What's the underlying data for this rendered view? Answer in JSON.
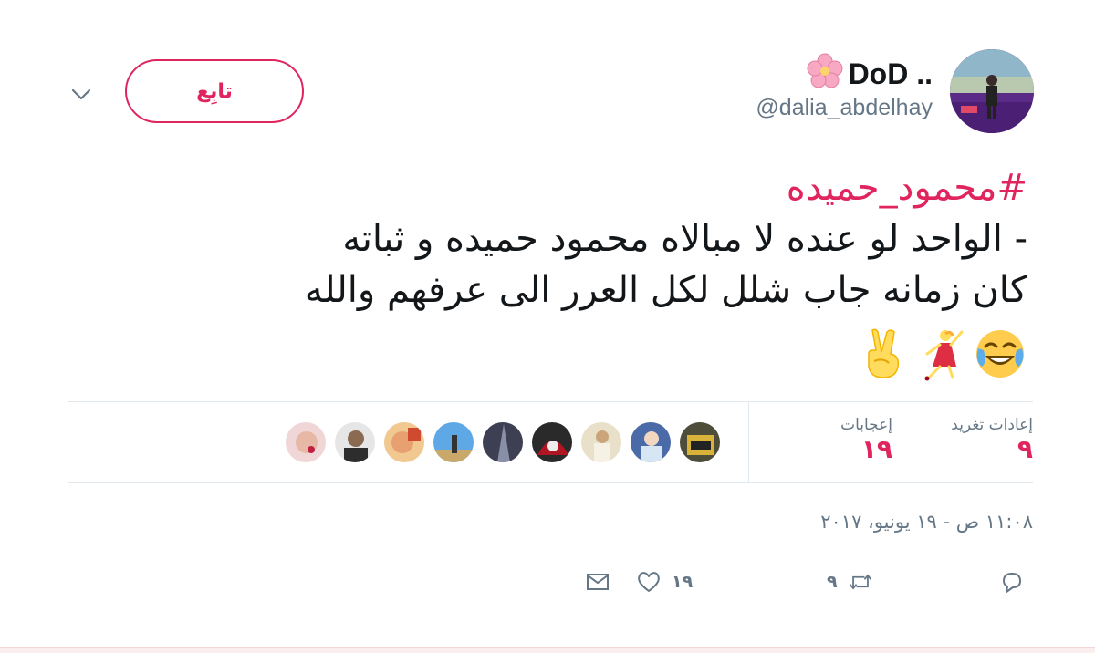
{
  "author": {
    "display_name": "DoD ..",
    "handle": "@dalia_abdelhay"
  },
  "header": {
    "follow_label": "تابِع",
    "caret_icon": "chevron-down-icon"
  },
  "tweet": {
    "hashtag": "#محمود_حميده",
    "line1": "- الواحد لو عنده لا مبالاه محمود حميده و ثباته",
    "line2": "كان زمانه جاب شلل لكل العرر الى عرفهم والله",
    "emojis": [
      "face-with-tears-of-joy-icon",
      "dancer-icon",
      "victory-hand-icon"
    ]
  },
  "stats": {
    "retweets_label": "إعادات تغريد",
    "retweets_count": "٩",
    "likes_label": "إعجابات",
    "likes_count": "١٩",
    "facepile_count": 9
  },
  "timestamp": "١١:٠٨ ص - ١٩ يونيو، ٢٠١٧",
  "actions": {
    "reply_icon": "reply-icon",
    "retweet_icon": "retweet-icon",
    "retweet_count": "٩",
    "like_icon": "heart-icon",
    "like_count": "١٩",
    "dm_icon": "envelope-icon"
  },
  "colors": {
    "accent": "#e0245e",
    "muted": "#657786",
    "divider": "#e1e8ed"
  }
}
